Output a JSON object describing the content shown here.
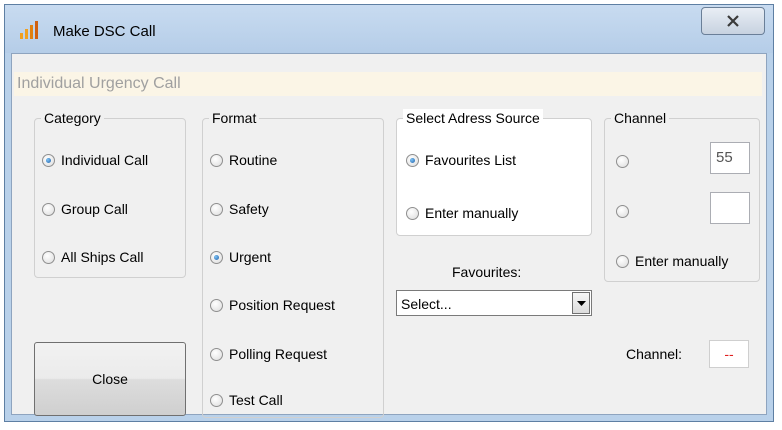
{
  "window": {
    "title": "Make DSC Call"
  },
  "banner": "Individual Urgency Call",
  "category": {
    "title": "Category",
    "options": [
      {
        "label": "Individual Call",
        "checked": true
      },
      {
        "label": "Group Call",
        "checked": false
      },
      {
        "label": "All Ships Call",
        "checked": false
      }
    ]
  },
  "format": {
    "title": "Format",
    "options": [
      {
        "label": "Routine",
        "checked": false
      },
      {
        "label": "Safety",
        "checked": false
      },
      {
        "label": "Urgent",
        "checked": true
      },
      {
        "label": "Position Request",
        "checked": false
      },
      {
        "label": "Polling Request",
        "checked": false
      },
      {
        "label": "Test Call",
        "checked": false
      }
    ]
  },
  "address_source": {
    "title": "Select Adress Source",
    "options": [
      {
        "label": "Favourites List",
        "checked": true
      },
      {
        "label": "Enter manually",
        "checked": false
      }
    ]
  },
  "favourites": {
    "label": "Favourites:",
    "selected": "Select..."
  },
  "channel": {
    "title": "Channel",
    "option1_value": "55",
    "option2_value": "",
    "enter_manually_label": "Enter manually"
  },
  "channel_readout": {
    "label": "Channel:",
    "value": "--"
  },
  "close_label": "Close",
  "colors": {
    "title_bar": "#b9d1ea",
    "banner": "#fbf5e6",
    "readout_text": "#e02020"
  }
}
